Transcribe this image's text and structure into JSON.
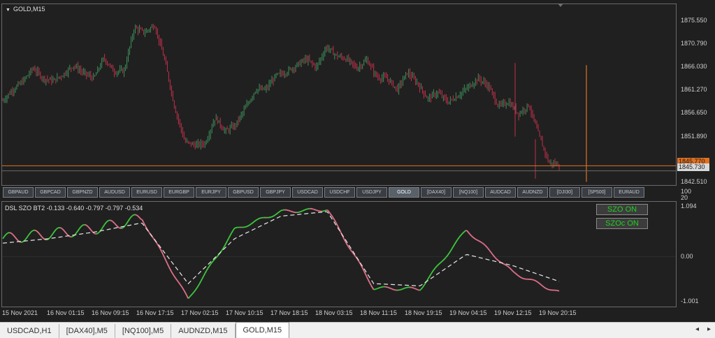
{
  "chart_title": "GOLD,M15",
  "osc_title": "DSL SZO BT2 -0.133 -0.640 -0.797 -0.797 -0.534",
  "symbols": [
    "GBPAUD",
    "GBPCAD",
    "GBPNZD",
    "AUDUSD",
    "EURUSD",
    "EURGBP",
    "EURJPY",
    "GBPUSD",
    "GBPJPY",
    "USDCAD",
    "USDCHF",
    "USDJPY",
    "GOLD",
    "[DAX40]",
    "[NQ100]",
    "AUDCAD",
    "AUDNZD",
    "[DJI30]",
    "[SP500]",
    "EURAUD"
  ],
  "active_symbol": "GOLD",
  "szo_buttons": [
    "SZO ON",
    "SZOc ON"
  ],
  "main_ticks": [
    "1875.550",
    "1870.790",
    "1866.030",
    "1861.270",
    "1856.650",
    "1851.890",
    "1845.730",
    "1842.510"
  ],
  "bid_tag": "1845.770",
  "ask_tag": "1845.730",
  "sep_ticks": [
    "100",
    "20"
  ],
  "osc_ticks": [
    "1.094",
    "0.00",
    "-1.001"
  ],
  "time_labels": [
    "15 Nov 2021",
    "16 Nov 01:15",
    "16 Nov 09:15",
    "16 Nov 17:15",
    "17 Nov 02:15",
    "17 Nov 10:15",
    "17 Nov 18:15",
    "18 Nov 03:15",
    "18 Nov 11:15",
    "18 Nov 19:15",
    "19 Nov 04:15",
    "19 Nov 12:15",
    "19 Nov 20:15"
  ],
  "tabs": [
    "USDCAD,H1",
    "[DAX40],M5",
    "[NQ100],M5",
    "AUDNZD,M15",
    "GOLD,M15"
  ],
  "active_tab": "GOLD,M15",
  "tab_arrows": [
    "◂",
    "▸"
  ],
  "colors": {
    "bull": "#3e8e5a",
    "bear": "#c0304a",
    "osc_up": "#3ec83e",
    "osc_down": "#e0708a",
    "signal": "#e8e8e8",
    "price_line": "#e07020",
    "szo_text": "#22d022"
  },
  "chart_data": [
    {
      "type": "candlestick",
      "title": "GOLD,M15",
      "ylim": [
        1842.1,
        1877.6
      ],
      "series": [
        {
          "values": [
            1858.6,
            1860.8,
            1862.4,
            1865.0,
            1863.0,
            1862.5,
            1863.8,
            1865.6,
            1864.0,
            1863.0,
            1867.0,
            1864.3,
            1864.5,
            1873.0,
            1872.0,
            1873.5,
            1866.6,
            1857.2,
            1850.5,
            1849.8,
            1850.2,
            1855.3,
            1852.5,
            1853.8,
            1857.2,
            1860.8,
            1860.8,
            1863.5,
            1864.2,
            1865.5,
            1866.8,
            1865.2,
            1869.2,
            1867.4,
            1866.8,
            1865.0,
            1866.6,
            1863.2,
            1863.0,
            1860.8,
            1864.2,
            1862.0,
            1859.0,
            1860.2,
            1858.3,
            1859.6,
            1861.2,
            1863.0,
            1861.5,
            1857.5,
            1858.3,
            1856.0,
            1857.8,
            1851.7,
            1846.3,
            1846.0
          ]
        }
      ],
      "reference_lines": [
        1845.77,
        1845.73
      ]
    },
    {
      "type": "line",
      "title": "DSL SZO BT2",
      "ylim": [
        -1.001,
        1.094
      ],
      "x": [
        "15 Nov 2021",
        "16 Nov 01:15",
        "16 Nov 09:15",
        "16 Nov 17:15",
        "17 Nov 02:15",
        "17 Nov 10:15",
        "17 Nov 18:15",
        "18 Nov 03:15",
        "18 Nov 11:15",
        "18 Nov 19:15",
        "19 Nov 04:15",
        "19 Nov 12:15",
        "19 Nov 20:15"
      ],
      "series": [
        {
          "values": [
            0.4,
            0.5,
            0.62,
            0.85,
            -0.95,
            0.6,
            1.0,
            1.05,
            -0.7,
            -0.72,
            0.6,
            -0.35,
            -0.8
          ]
        },
        {
          "values": [
            0.3,
            0.4,
            0.55,
            0.75,
            -0.6,
            0.4,
            0.9,
            1.0,
            -0.6,
            -0.65,
            0.05,
            -0.2,
            -0.55
          ]
        }
      ]
    }
  ]
}
